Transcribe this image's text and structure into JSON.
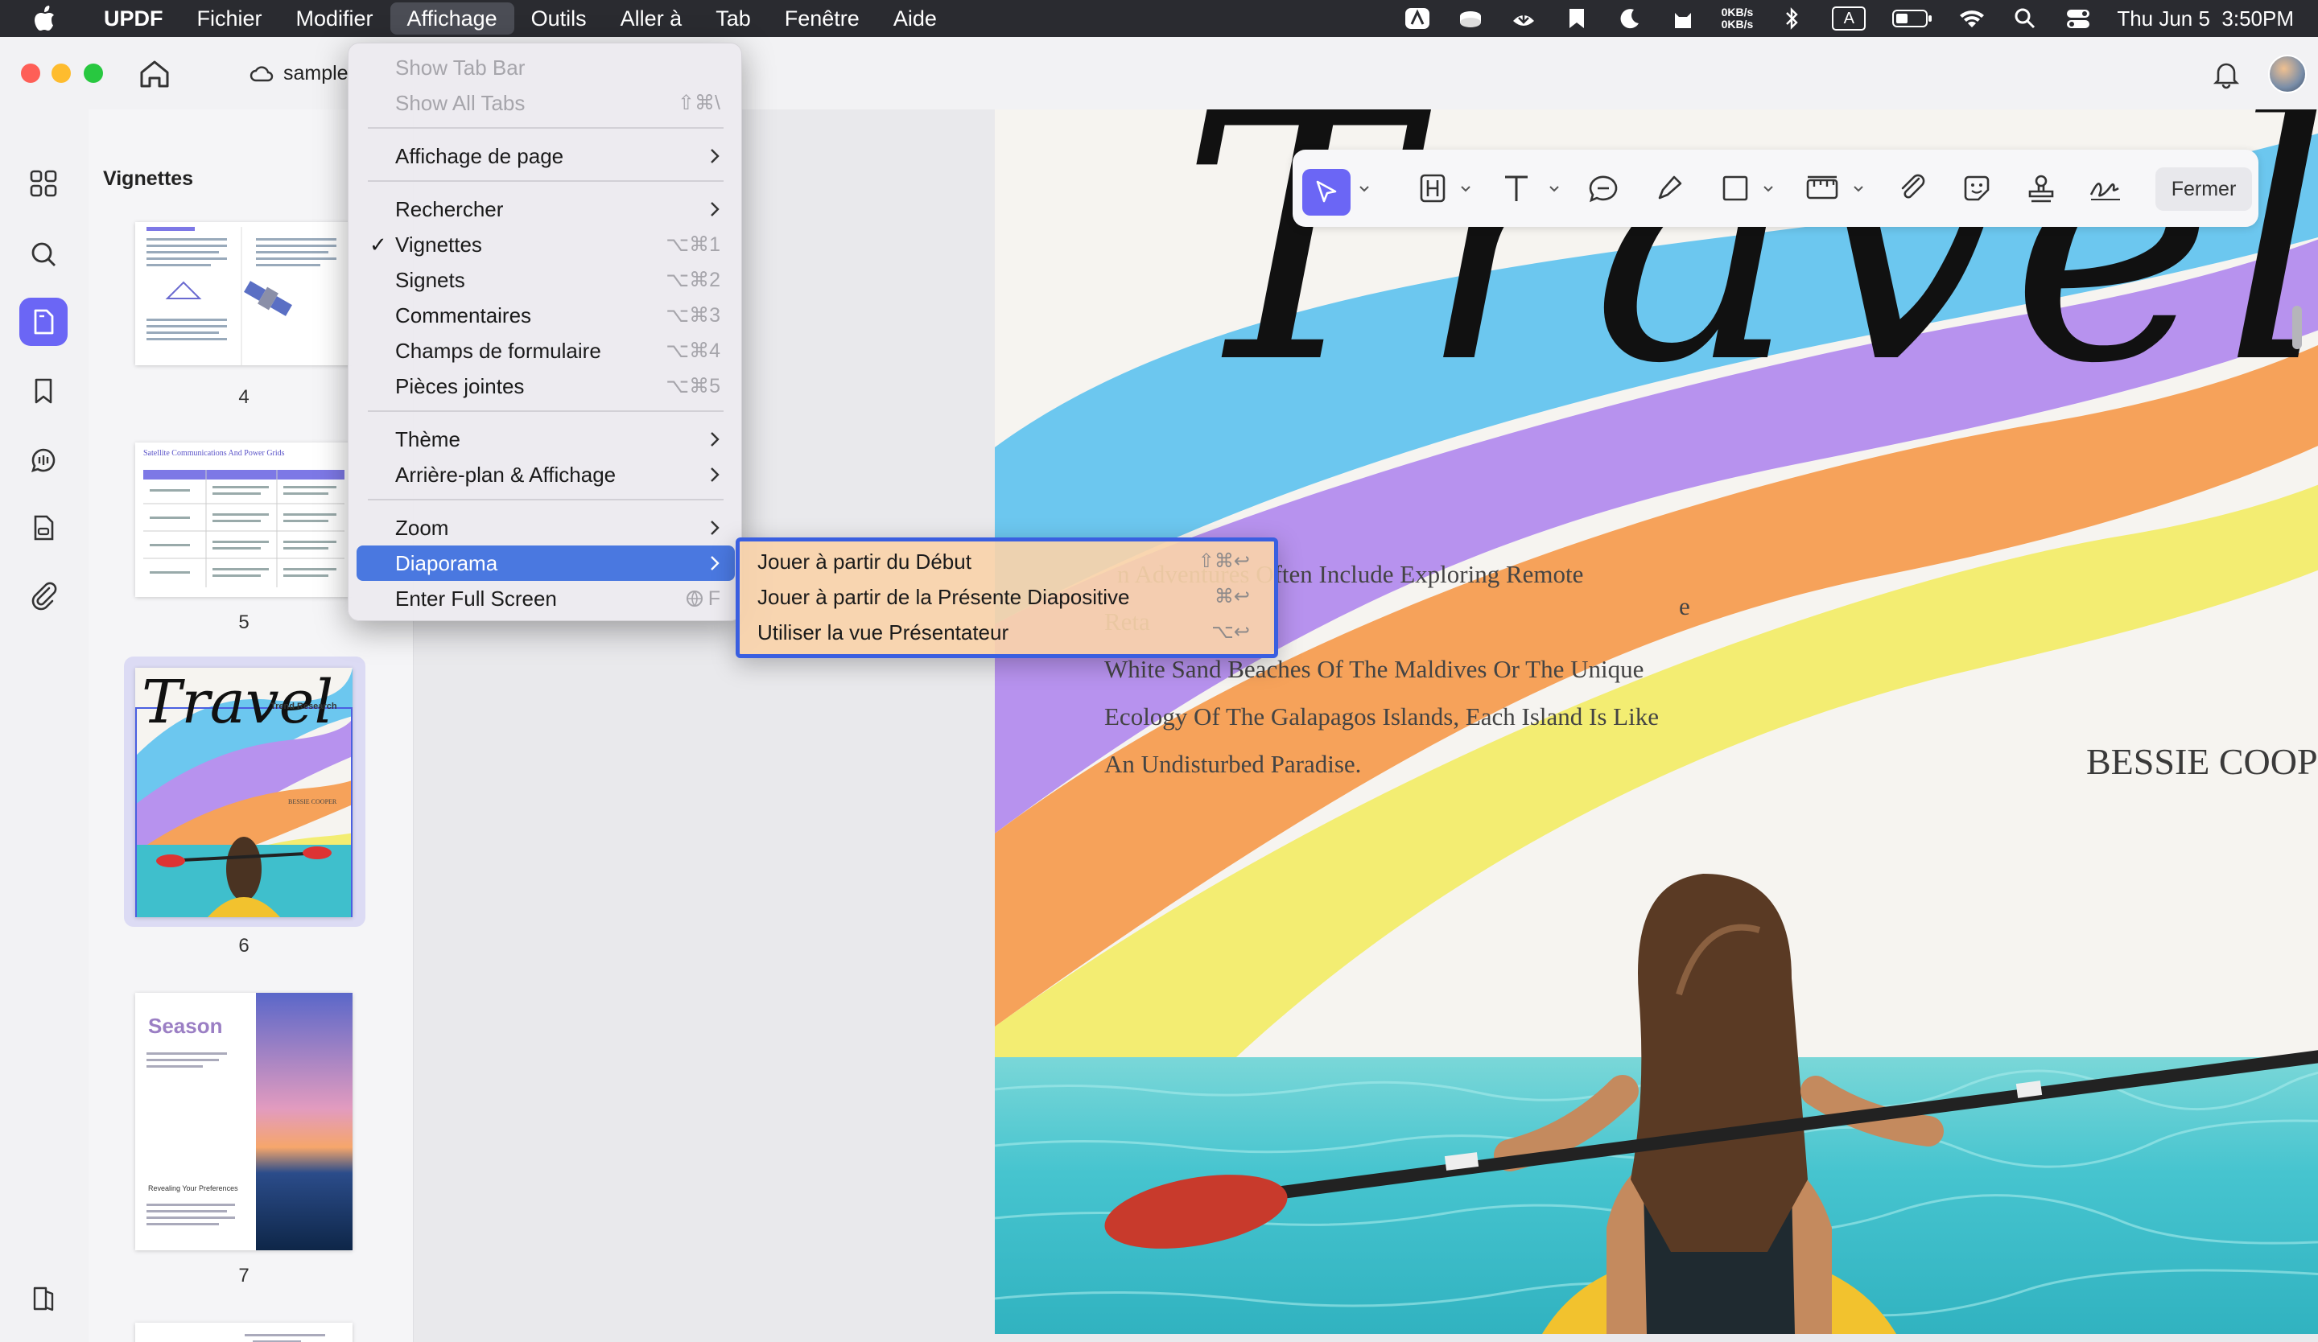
{
  "menubar": {
    "app_name": "UPDF",
    "items": [
      "Fichier",
      "Modifier",
      "Affichage",
      "Outils",
      "Aller à",
      "Tab",
      "Fenêtre",
      "Aide"
    ],
    "active_item": "Affichage",
    "net_up": "0KB/s",
    "net_down": "0KB/s",
    "input_source": "A",
    "clock": "Thu Jun 5  3:50PM"
  },
  "window": {
    "doc_tab": "sample"
  },
  "thumbnails": {
    "title": "Vignettes",
    "pages": [
      "4",
      "5",
      "6",
      "7"
    ],
    "selected_page": "6",
    "page5_heading": "Satellite Communications And Power Grids",
    "page6_title": "Travel",
    "page6_subtitle": "Trend Research",
    "page6_author": "BESSIE COOPER",
    "page7_title": "Season",
    "page7_footer": "Revealing Your Preferences"
  },
  "toolbar": {
    "close_label": "Fermer"
  },
  "view_menu": {
    "items": [
      {
        "label": "Show Tab Bar",
        "shortcut": "",
        "disabled": true
      },
      {
        "label": "Show All Tabs",
        "shortcut": "⇧⌘\\",
        "disabled": true
      },
      {
        "label": "Affichage de page",
        "submenu": true
      },
      {
        "label": "Rechercher",
        "submenu": true
      },
      {
        "label": "Vignettes",
        "shortcut": "⌥⌘1",
        "checked": true
      },
      {
        "label": "Signets",
        "shortcut": "⌥⌘2"
      },
      {
        "label": "Commentaires",
        "shortcut": "⌥⌘3"
      },
      {
        "label": "Champs de formulaire",
        "shortcut": "⌥⌘4"
      },
      {
        "label": "Pièces jointes",
        "shortcut": "⌥⌘5"
      },
      {
        "label": "Thème",
        "submenu": true
      },
      {
        "label": "Arrière-plan & Affichage",
        "submenu": true
      },
      {
        "label": "Zoom",
        "submenu": true
      },
      {
        "label": "Diaporama",
        "submenu": true,
        "highlighted": true
      },
      {
        "label": "Enter Full Screen",
        "shortcut": "F"
      }
    ],
    "check_glyph": "✓"
  },
  "diaporama_submenu": {
    "items": [
      {
        "label": "Jouer à partir du Début",
        "shortcut": "⇧⌘↩"
      },
      {
        "label": "Jouer à partir de la Présente Diapositive",
        "shortcut": "⌘↩"
      },
      {
        "label": "Utiliser la vue Présentateur",
        "shortcut": "⌥↩"
      }
    ]
  },
  "page": {
    "title_word": "Travel",
    "body_lines": [
      "n Adventures Often Include Exploring Remote",
      "Reta",
      "White Sand Beaches Of The Maldives Or The Unique",
      "Ecology Of The Galapagos Islands, Each Island Is Like",
      "An Undisturbed Paradise."
    ],
    "body_fragment_e": "e",
    "author": "BESSIE COOPER"
  },
  "colors": {
    "accent": "#6b66f5",
    "menu_highlight": "#4a78e0",
    "submenu_border": "#3a5fe0",
    "wave_blue": "#6cc7ef",
    "wave_purple": "#b792ee",
    "wave_orange": "#f6a25a",
    "wave_yellow": "#f3ed72"
  }
}
